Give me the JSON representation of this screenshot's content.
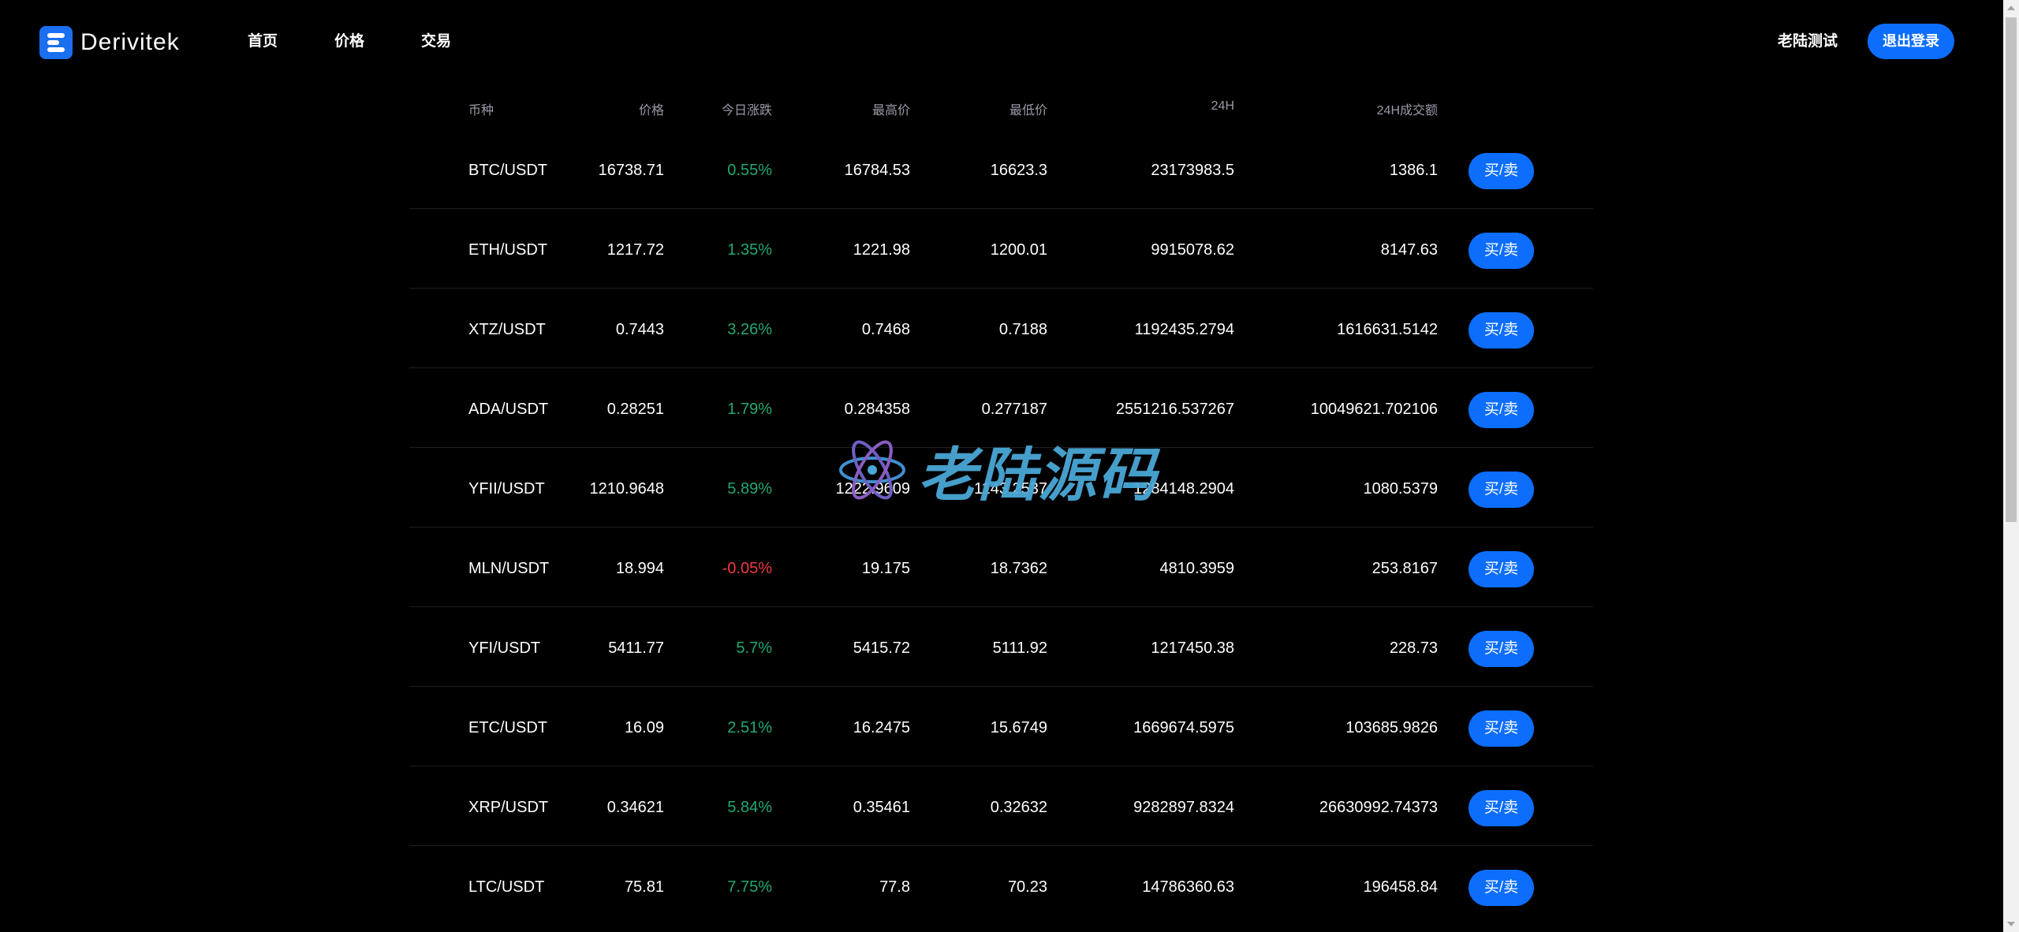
{
  "header": {
    "brand": "Derivitek",
    "nav": [
      "首页",
      "价格",
      "交易"
    ],
    "user_name": "老陆测试",
    "logout_label": "退出登录"
  },
  "table": {
    "columns": [
      "币种",
      "价格",
      "今日涨跌",
      "最高价",
      "最低价",
      "24H",
      "24H成交额"
    ],
    "action_label": "买/卖",
    "rows": [
      {
        "symbol": "BTC/USDT",
        "price": "16738.71",
        "change": "0.55%",
        "direction": "up",
        "high": "16784.53",
        "low": "16623.3",
        "vol": "23173983.5",
        "amount": "1386.1"
      },
      {
        "symbol": "ETH/USDT",
        "price": "1217.72",
        "change": "1.35%",
        "direction": "up",
        "high": "1221.98",
        "low": "1200.01",
        "vol": "9915078.62",
        "amount": "8147.63"
      },
      {
        "symbol": "XTZ/USDT",
        "price": "0.7443",
        "change": "3.26%",
        "direction": "up",
        "high": "0.7468",
        "low": "0.7188",
        "vol": "1192435.2794",
        "amount": "1616631.5142"
      },
      {
        "symbol": "ADA/USDT",
        "price": "0.28251",
        "change": "1.79%",
        "direction": "up",
        "high": "0.284358",
        "low": "0.277187",
        "vol": "2551216.537267",
        "amount": "10049621.702106"
      },
      {
        "symbol": "YFII/USDT",
        "price": "1210.9648",
        "change": "5.89%",
        "direction": "up",
        "high": "1222.9609",
        "low": "1143.2537",
        "vol": "1284148.2904",
        "amount": "1080.5379"
      },
      {
        "symbol": "MLN/USDT",
        "price": "18.994",
        "change": "-0.05%",
        "direction": "down",
        "high": "19.175",
        "low": "18.7362",
        "vol": "4810.3959",
        "amount": "253.8167"
      },
      {
        "symbol": "YFI/USDT",
        "price": "5411.77",
        "change": "5.7%",
        "direction": "up",
        "high": "5415.72",
        "low": "5111.92",
        "vol": "1217450.38",
        "amount": "228.73"
      },
      {
        "symbol": "ETC/USDT",
        "price": "16.09",
        "change": "2.51%",
        "direction": "up",
        "high": "16.2475",
        "low": "15.6749",
        "vol": "1669674.5975",
        "amount": "103685.9826"
      },
      {
        "symbol": "XRP/USDT",
        "price": "0.34621",
        "change": "5.84%",
        "direction": "up",
        "high": "0.35461",
        "low": "0.32632",
        "vol": "9282897.8324",
        "amount": "26630992.74373"
      },
      {
        "symbol": "LTC/USDT",
        "price": "75.81",
        "change": "7.75%",
        "direction": "up",
        "high": "77.8",
        "low": "70.23",
        "vol": "14786360.63",
        "amount": "196458.84"
      }
    ]
  },
  "watermark": {
    "text": "老陆源码"
  },
  "colors": {
    "accent": "#0d6efd",
    "up": "#21a970",
    "down": "#f0393d",
    "background": "#000000"
  }
}
